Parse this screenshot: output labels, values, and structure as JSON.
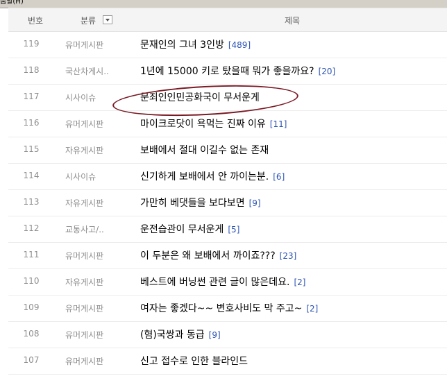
{
  "menu": {
    "help_label": "움말(H)"
  },
  "header": {
    "no_label": "번호",
    "category_label": "분류",
    "title_label": "제목"
  },
  "colors": {
    "comment_count": "#2b53b5",
    "highlight_oval": "#7a1a25",
    "meta_text": "#8e8e8e"
  },
  "posts": [
    {
      "no": "119",
      "category": "유머게시판",
      "title": "문재인의 그녀 3인방",
      "comments": "[489]"
    },
    {
      "no": "118",
      "category": "국산차게시..",
      "title": "1년에 15000 키로 탔을때 뭐가 좋을까요?",
      "comments": "[20]"
    },
    {
      "no": "117",
      "category": "시사이슈",
      "title": "문죄인인민공화국이 무서운게",
      "comments": ""
    },
    {
      "no": "116",
      "category": "유머게시판",
      "title": "마이크로닷이 욕먹는 진짜 이유",
      "comments": "[11]"
    },
    {
      "no": "115",
      "category": "자유게시판",
      "title": "보배에서 절대 이길수 없는 존재",
      "comments": ""
    },
    {
      "no": "114",
      "category": "시사이슈",
      "title": "신기하게 보배에서 안 까이는분.",
      "comments": "[6]"
    },
    {
      "no": "113",
      "category": "자유게시판",
      "title": "가만히 베댓들을 보다보면",
      "comments": "[9]"
    },
    {
      "no": "112",
      "category": "교통사고/..",
      "title": "운전습관이 무서운게",
      "comments": "[5]"
    },
    {
      "no": "111",
      "category": "유머게시판",
      "title": "이 두분은 왜 보배에서 까이죠???",
      "comments": "[23]"
    },
    {
      "no": "110",
      "category": "자유게시판",
      "title": "베스트에 버닝썬 관련 글이 많은데요.",
      "comments": "[2]"
    },
    {
      "no": "109",
      "category": "유머게시판",
      "title": "여자는 좋겠다~~ 변호사비도 막 주고~",
      "comments": "[2]"
    },
    {
      "no": "108",
      "category": "유머게시판",
      "title": "(혐)국쌍과 동급",
      "comments": "[9]"
    },
    {
      "no": "107",
      "category": "유머게시판",
      "title": "신고 접수로 인한 블라인드",
      "comments": ""
    }
  ]
}
